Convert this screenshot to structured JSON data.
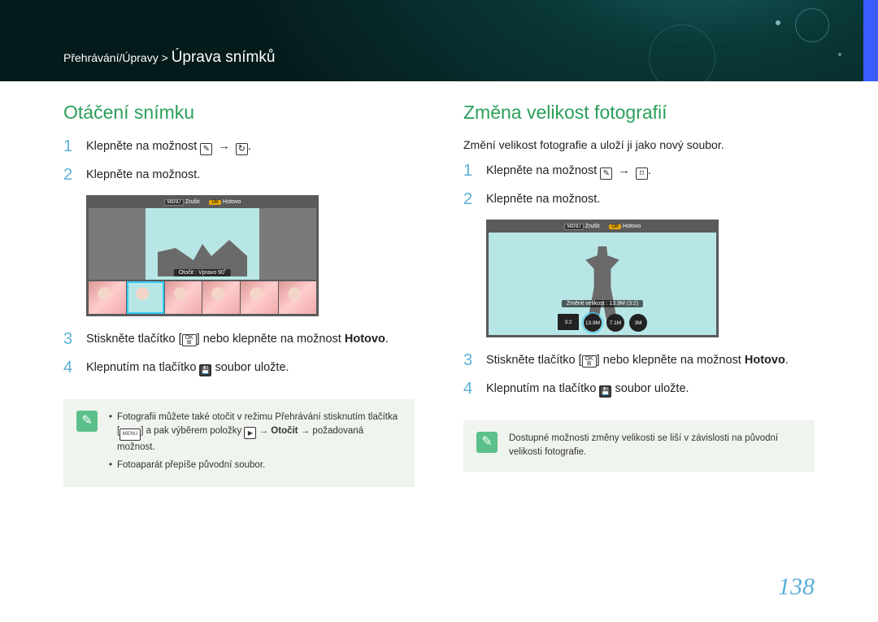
{
  "breadcrumb": {
    "path": "Přehrávání/Úpravy >",
    "page": "Úprava snímků"
  },
  "left": {
    "title": "Otáčení snímku",
    "step1": "Klepněte na možnost ",
    "step2": "Klepněte na možnost.",
    "step3a": "Stiskněte tlačítko [",
    "step3b": "] nebo klepněte na možnost ",
    "step3c": "Hotovo",
    "step4a": "Klepnutím na tlačítko ",
    "step4b": " soubor uložte.",
    "screenshot": {
      "menu_label": "MENU",
      "cancel": "Zrušit",
      "ok_label": "OK",
      "done": "Hotovo",
      "caption": "Otočit : Vpravo 90˚"
    },
    "note1a": "Fotografii můžete také otočit v režimu Přehrávání stisknutím tlačítka [",
    "note1_menu": "MENU",
    "note1b": "] a pak výběrem položky ",
    "note1c": " → ",
    "note1_bold": "Otočit",
    "note1d": " → požadovaná možnost.",
    "note2": "Fotoaparát přepíše původní soubor."
  },
  "right": {
    "title": "Změna velikost fotografií",
    "intro": "Změní velikost fotografie a uloží ji jako nový soubor.",
    "step1": "Klepněte na možnost ",
    "step2": "Klepněte na možnost.",
    "step3a": "Stiskněte tlačítko [",
    "step3b": "] nebo klepněte na možnost ",
    "step3c": "Hotovo",
    "step4a": "Klepnutím na tlačítko ",
    "step4b": " soubor uložte.",
    "screenshot": {
      "menu_label": "MENU",
      "cancel": "Zrušit",
      "ok_label": "OK",
      "done": "Hotovo",
      "caption": "Změnit velikost : 13.9M (3:2)",
      "options": [
        "3:2",
        "13.9M",
        "7.1M",
        "3M"
      ]
    },
    "note": "Dostupné možnosti změny velikosti se liší v závislosti na původní velikosti fotografie."
  },
  "page_number": "138"
}
